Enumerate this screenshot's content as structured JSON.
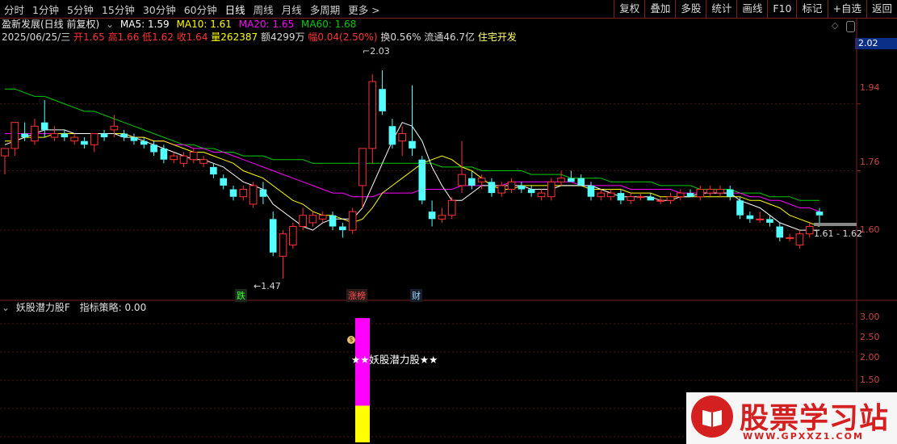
{
  "toolbar": {
    "tabs": [
      {
        "label": "分时"
      },
      {
        "label": "1分钟"
      },
      {
        "label": "5分钟"
      },
      {
        "label": "15分钟"
      },
      {
        "label": "30分钟"
      },
      {
        "label": "60分钟"
      },
      {
        "label": "日线",
        "active": true
      },
      {
        "label": "周线"
      },
      {
        "label": "月线"
      },
      {
        "label": "多周期"
      },
      {
        "label": "更多 >"
      }
    ],
    "tools": [
      "复权",
      "叠加",
      "多股",
      "统计",
      "画线",
      "F10",
      "标记",
      "+自选",
      "返回"
    ]
  },
  "header": {
    "stock": "盈新发展(日线 前复权)",
    "ma5": "MA5: 1.59",
    "ma10": "MA10: 1.61",
    "ma20": "MA20: 1.65",
    "ma60": "MA60: 1.68"
  },
  "quote": {
    "date": "2025/06/25/三",
    "open": "开1.65",
    "high": "高1.66",
    "low": "低1.62",
    "close": "收1.64",
    "volume": "量262387",
    "amount": "额4299万",
    "change": "幅0.04(2.50%)",
    "turnover": "换0.56%",
    "float": "流通46.7亿",
    "sector": "住宅开发"
  },
  "axis": {
    "price_box": "2.02",
    "ticks": [
      "1.94",
      "1.76",
      "1.60"
    ],
    "ind_ticks": [
      "3.00",
      "2.50",
      "2.00",
      "1.50"
    ]
  },
  "markers": {
    "high_label": "2.03",
    "low_label": "1.47",
    "range_label": "1.61 - 1.62",
    "m1": "跌",
    "m2": "涨榜",
    "m3": "财"
  },
  "indicator": {
    "title": "妖股潜力股F",
    "strategy": "指标策略: 0.00",
    "signal_label": "★★妖股潜力股★★",
    "coin": "$"
  },
  "watermark": {
    "text": "股票学习站",
    "url": "WWW.GPXXZ1.COM"
  },
  "colors": {
    "up": "#ff3232",
    "down": "#54ffff",
    "ma5": "#ffffff",
    "ma10": "#ffff00",
    "ma20": "#ff00ff",
    "ma60": "#00cc00",
    "frame": "#7a1f1f"
  },
  "chart_data": {
    "type": "candlestick",
    "series": [
      {
        "name": "MA5"
      },
      {
        "name": "MA10"
      },
      {
        "name": "MA20"
      },
      {
        "name": "MA60"
      }
    ],
    "candles": [
      {
        "o": 1.8,
        "h": 1.82,
        "l": 1.75,
        "c": 1.82
      },
      {
        "o": 1.82,
        "h": 1.89,
        "l": 1.8,
        "c": 1.89
      },
      {
        "o": 1.86,
        "h": 1.89,
        "l": 1.84,
        "c": 1.85
      },
      {
        "o": 1.84,
        "h": 1.9,
        "l": 1.83,
        "c": 1.88
      },
      {
        "o": 1.89,
        "h": 1.95,
        "l": 1.85,
        "c": 1.87
      },
      {
        "o": 1.85,
        "h": 1.88,
        "l": 1.84,
        "c": 1.86
      },
      {
        "o": 1.86,
        "h": 1.87,
        "l": 1.84,
        "c": 1.85
      },
      {
        "o": 1.84,
        "h": 1.86,
        "l": 1.83,
        "c": 1.85
      },
      {
        "o": 1.84,
        "h": 1.85,
        "l": 1.82,
        "c": 1.83
      },
      {
        "o": 1.83,
        "h": 1.86,
        "l": 1.81,
        "c": 1.86
      },
      {
        "o": 1.86,
        "h": 1.87,
        "l": 1.84,
        "c": 1.85
      },
      {
        "o": 1.87,
        "h": 1.91,
        "l": 1.85,
        "c": 1.88
      },
      {
        "o": 1.86,
        "h": 1.87,
        "l": 1.84,
        "c": 1.85
      },
      {
        "o": 1.85,
        "h": 1.86,
        "l": 1.83,
        "c": 1.84
      },
      {
        "o": 1.84,
        "h": 1.85,
        "l": 1.82,
        "c": 1.83
      },
      {
        "o": 1.83,
        "h": 1.84,
        "l": 1.8,
        "c": 1.81
      },
      {
        "o": 1.82,
        "h": 1.83,
        "l": 1.78,
        "c": 1.79
      },
      {
        "o": 1.79,
        "h": 1.81,
        "l": 1.78,
        "c": 1.8
      },
      {
        "o": 1.78,
        "h": 1.81,
        "l": 1.77,
        "c": 1.8
      },
      {
        "o": 1.79,
        "h": 1.82,
        "l": 1.78,
        "c": 1.81
      },
      {
        "o": 1.78,
        "h": 1.8,
        "l": 1.77,
        "c": 1.79
      },
      {
        "o": 1.77,
        "h": 1.78,
        "l": 1.74,
        "c": 1.75
      },
      {
        "o": 1.74,
        "h": 1.75,
        "l": 1.71,
        "c": 1.72
      },
      {
        "o": 1.71,
        "h": 1.72,
        "l": 1.68,
        "c": 1.69
      },
      {
        "o": 1.69,
        "h": 1.72,
        "l": 1.68,
        "c": 1.71
      },
      {
        "o": 1.67,
        "h": 1.73,
        "l": 1.66,
        "c": 1.72
      },
      {
        "o": 1.71,
        "h": 1.73,
        "l": 1.67,
        "c": 1.69
      },
      {
        "o": 1.63,
        "h": 1.65,
        "l": 1.53,
        "c": 1.54
      },
      {
        "o": 1.53,
        "h": 1.6,
        "l": 1.47,
        "c": 1.59
      },
      {
        "o": 1.56,
        "h": 1.62,
        "l": 1.55,
        "c": 1.61
      },
      {
        "o": 1.61,
        "h": 1.66,
        "l": 1.6,
        "c": 1.64
      },
      {
        "o": 1.62,
        "h": 1.65,
        "l": 1.61,
        "c": 1.64
      },
      {
        "o": 1.63,
        "h": 1.65,
        "l": 1.62,
        "c": 1.64
      },
      {
        "o": 1.64,
        "h": 1.65,
        "l": 1.6,
        "c": 1.61
      },
      {
        "o": 1.61,
        "h": 1.62,
        "l": 1.58,
        "c": 1.6
      },
      {
        "o": 1.6,
        "h": 1.66,
        "l": 1.59,
        "c": 1.65
      },
      {
        "o": 1.72,
        "h": 1.82,
        "l": 1.66,
        "c": 1.82
      },
      {
        "o": 1.82,
        "h": 2.02,
        "l": 1.78,
        "c": 2.0
      },
      {
        "o": 1.98,
        "h": 2.03,
        "l": 1.91,
        "c": 1.92
      },
      {
        "o": 1.88,
        "h": 1.9,
        "l": 1.82,
        "c": 1.83
      },
      {
        "o": 1.84,
        "h": 1.88,
        "l": 1.8,
        "c": 1.86
      },
      {
        "o": 1.84,
        "h": 1.99,
        "l": 1.8,
        "c": 1.82
      },
      {
        "o": 1.79,
        "h": 1.8,
        "l": 1.67,
        "c": 1.68
      },
      {
        "o": 1.65,
        "h": 1.68,
        "l": 1.61,
        "c": 1.63
      },
      {
        "o": 1.63,
        "h": 1.66,
        "l": 1.62,
        "c": 1.64
      },
      {
        "o": 1.64,
        "h": 1.69,
        "l": 1.63,
        "c": 1.68
      },
      {
        "o": 1.72,
        "h": 1.84,
        "l": 1.7,
        "c": 1.75
      },
      {
        "o": 1.74,
        "h": 1.76,
        "l": 1.71,
        "c": 1.72
      },
      {
        "o": 1.73,
        "h": 1.75,
        "l": 1.71,
        "c": 1.74
      },
      {
        "o": 1.73,
        "h": 1.74,
        "l": 1.69,
        "c": 1.7
      },
      {
        "o": 1.7,
        "h": 1.73,
        "l": 1.69,
        "c": 1.72
      },
      {
        "o": 1.71,
        "h": 1.74,
        "l": 1.7,
        "c": 1.73
      },
      {
        "o": 1.72,
        "h": 1.73,
        "l": 1.7,
        "c": 1.71
      },
      {
        "o": 1.71,
        "h": 1.72,
        "l": 1.69,
        "c": 1.7
      },
      {
        "o": 1.69,
        "h": 1.71,
        "l": 1.68,
        "c": 1.7
      },
      {
        "o": 1.69,
        "h": 1.74,
        "l": 1.68,
        "c": 1.73
      },
      {
        "o": 1.73,
        "h": 1.76,
        "l": 1.72,
        "c": 1.74
      },
      {
        "o": 1.74,
        "h": 1.76,
        "l": 1.73,
        "c": 1.73
      },
      {
        "o": 1.74,
        "h": 1.75,
        "l": 1.72,
        "c": 1.72
      },
      {
        "o": 1.72,
        "h": 1.73,
        "l": 1.68,
        "c": 1.69
      },
      {
        "o": 1.69,
        "h": 1.71,
        "l": 1.68,
        "c": 1.7
      },
      {
        "o": 1.69,
        "h": 1.71,
        "l": 1.68,
        "c": 1.7
      },
      {
        "o": 1.7,
        "h": 1.71,
        "l": 1.67,
        "c": 1.68
      },
      {
        "o": 1.68,
        "h": 1.7,
        "l": 1.67,
        "c": 1.69
      },
      {
        "o": 1.69,
        "h": 1.7,
        "l": 1.68,
        "c": 1.69
      },
      {
        "o": 1.69,
        "h": 1.7,
        "l": 1.68,
        "c": 1.68
      },
      {
        "o": 1.68,
        "h": 1.69,
        "l": 1.67,
        "c": 1.68
      },
      {
        "o": 1.68,
        "h": 1.7,
        "l": 1.67,
        "c": 1.69
      },
      {
        "o": 1.69,
        "h": 1.71,
        "l": 1.68,
        "c": 1.7
      },
      {
        "o": 1.7,
        "h": 1.71,
        "l": 1.69,
        "c": 1.69
      },
      {
        "o": 1.69,
        "h": 1.72,
        "l": 1.68,
        "c": 1.71
      },
      {
        "o": 1.7,
        "h": 1.72,
        "l": 1.69,
        "c": 1.71
      },
      {
        "o": 1.7,
        "h": 1.72,
        "l": 1.69,
        "c": 1.71
      },
      {
        "o": 1.71,
        "h": 1.72,
        "l": 1.68,
        "c": 1.69
      },
      {
        "o": 1.68,
        "h": 1.69,
        "l": 1.63,
        "c": 1.64
      },
      {
        "o": 1.64,
        "h": 1.65,
        "l": 1.62,
        "c": 1.63
      },
      {
        "o": 1.63,
        "h": 1.65,
        "l": 1.62,
        "c": 1.63
      },
      {
        "o": 1.63,
        "h": 1.64,
        "l": 1.61,
        "c": 1.62
      },
      {
        "o": 1.61,
        "h": 1.62,
        "l": 1.57,
        "c": 1.58
      },
      {
        "o": 1.58,
        "h": 1.59,
        "l": 1.57,
        "c": 1.58
      },
      {
        "o": 1.56,
        "h": 1.6,
        "l": 1.55,
        "c": 1.59
      },
      {
        "o": 1.59,
        "h": 1.62,
        "l": 1.58,
        "c": 1.61
      },
      {
        "o": 1.65,
        "h": 1.66,
        "l": 1.62,
        "c": 1.64
      }
    ],
    "ma5": [
      1.83,
      1.84,
      1.85,
      1.86,
      1.87,
      1.87,
      1.87,
      1.86,
      1.86,
      1.86,
      1.86,
      1.86,
      1.85,
      1.85,
      1.84,
      1.83,
      1.82,
      1.81,
      1.8,
      1.79,
      1.79,
      1.78,
      1.77,
      1.75,
      1.73,
      1.72,
      1.71,
      1.67,
      1.65,
      1.63,
      1.61,
      1.6,
      1.62,
      1.63,
      1.63,
      1.63,
      1.66,
      1.72,
      1.78,
      1.84,
      1.89,
      1.88,
      1.84,
      1.77,
      1.72,
      1.68,
      1.68,
      1.7,
      1.72,
      1.72,
      1.72,
      1.72,
      1.72,
      1.71,
      1.71,
      1.71,
      1.72,
      1.72,
      1.72,
      1.72,
      1.71,
      1.7,
      1.69,
      1.69,
      1.69,
      1.69,
      1.68,
      1.68,
      1.69,
      1.69,
      1.7,
      1.7,
      1.7,
      1.7,
      1.68,
      1.67,
      1.66,
      1.64,
      1.62,
      1.61,
      1.6,
      1.6,
      1.6
    ],
    "ma10": [
      1.84,
      1.84,
      1.85,
      1.85,
      1.85,
      1.86,
      1.86,
      1.86,
      1.86,
      1.86,
      1.86,
      1.86,
      1.86,
      1.85,
      1.85,
      1.84,
      1.84,
      1.83,
      1.82,
      1.81,
      1.81,
      1.8,
      1.79,
      1.78,
      1.76,
      1.75,
      1.74,
      1.72,
      1.7,
      1.68,
      1.67,
      1.65,
      1.64,
      1.64,
      1.63,
      1.62,
      1.63,
      1.66,
      1.7,
      1.72,
      1.74,
      1.76,
      1.78,
      1.79,
      1.8,
      1.79,
      1.77,
      1.76,
      1.74,
      1.72,
      1.71,
      1.71,
      1.72,
      1.72,
      1.72,
      1.72,
      1.72,
      1.72,
      1.72,
      1.71,
      1.71,
      1.71,
      1.71,
      1.7,
      1.7,
      1.7,
      1.69,
      1.69,
      1.69,
      1.69,
      1.69,
      1.69,
      1.69,
      1.69,
      1.69,
      1.68,
      1.68,
      1.67,
      1.66,
      1.64,
      1.63,
      1.62,
      1.61
    ],
    "ma20": [
      1.86,
      1.86,
      1.86,
      1.86,
      1.86,
      1.86,
      1.86,
      1.86,
      1.86,
      1.86,
      1.86,
      1.86,
      1.86,
      1.85,
      1.85,
      1.84,
      1.84,
      1.83,
      1.83,
      1.82,
      1.82,
      1.81,
      1.81,
      1.8,
      1.79,
      1.78,
      1.77,
      1.76,
      1.75,
      1.74,
      1.73,
      1.72,
      1.71,
      1.7,
      1.7,
      1.69,
      1.69,
      1.69,
      1.7,
      1.7,
      1.7,
      1.7,
      1.71,
      1.71,
      1.71,
      1.71,
      1.72,
      1.72,
      1.72,
      1.72,
      1.72,
      1.73,
      1.73,
      1.73,
      1.73,
      1.73,
      1.73,
      1.73,
      1.72,
      1.72,
      1.72,
      1.72,
      1.72,
      1.71,
      1.71,
      1.71,
      1.71,
      1.71,
      1.7,
      1.7,
      1.7,
      1.7,
      1.7,
      1.7,
      1.7,
      1.69,
      1.69,
      1.68,
      1.68,
      1.67,
      1.66,
      1.66,
      1.65
    ],
    "ma60": [
      1.98,
      1.98,
      1.97,
      1.96,
      1.96,
      1.95,
      1.94,
      1.93,
      1.92,
      1.92,
      1.91,
      1.9,
      1.89,
      1.88,
      1.87,
      1.86,
      1.85,
      1.84,
      1.83,
      1.83,
      1.82,
      1.82,
      1.81,
      1.81,
      1.8,
      1.8,
      1.8,
      1.79,
      1.79,
      1.79,
      1.79,
      1.78,
      1.78,
      1.78,
      1.78,
      1.78,
      1.78,
      1.78,
      1.78,
      1.78,
      1.78,
      1.78,
      1.78,
      1.78,
      1.77,
      1.77,
      1.77,
      1.77,
      1.76,
      1.76,
      1.76,
      1.76,
      1.76,
      1.75,
      1.75,
      1.75,
      1.75,
      1.74,
      1.74,
      1.74,
      1.74,
      1.73,
      1.73,
      1.73,
      1.73,
      1.73,
      1.72,
      1.72,
      1.72,
      1.72,
      1.71,
      1.71,
      1.71,
      1.71,
      1.7,
      1.7,
      1.7,
      1.69,
      1.69,
      1.69,
      1.68,
      1.68,
      1.68
    ],
    "ylim": [
      1.42,
      2.1
    ],
    "indicator": {
      "signal_index": 36,
      "bars": [
        {
          "type": "yellow",
          "from": 0,
          "to": 1.55
        },
        {
          "type": "magenta",
          "from": 1.55,
          "to": 3.1
        }
      ],
      "ylim": [
        0.9,
        3.3
      ]
    }
  }
}
